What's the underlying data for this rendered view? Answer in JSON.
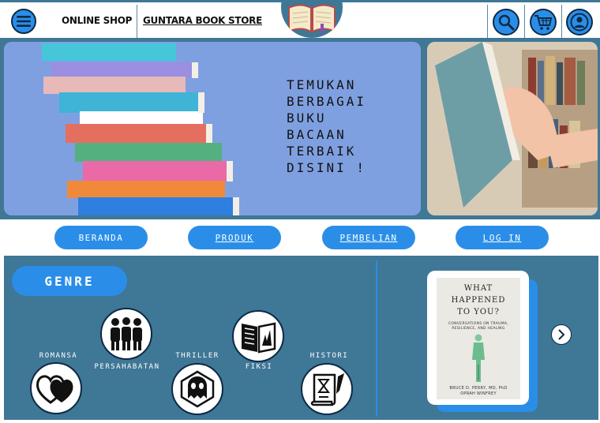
{
  "header": {
    "menu_icon": "hamburger-icon",
    "shop_label": "ONLINE SHOP",
    "store_name": "GUNTARA BOOK STORE",
    "logo_icon": "open-book-icon",
    "actions": [
      {
        "icon": "search-icon"
      },
      {
        "icon": "cart-icon"
      },
      {
        "icon": "user-icon"
      }
    ]
  },
  "banner": {
    "headline_lines": [
      "TEMUKAN",
      "BERBAGAI",
      "BUKU",
      "BACAAN",
      "TERBAIK",
      "DISINI !"
    ]
  },
  "nav": {
    "items": [
      {
        "label": "BERANDA"
      },
      {
        "label": "PRODUK"
      },
      {
        "label": "PEMBELIAN"
      },
      {
        "label": "LOG IN"
      }
    ]
  },
  "genre": {
    "button_label": "GENRE",
    "items": [
      {
        "label": "ROMANSA",
        "icon": "hearts-icon"
      },
      {
        "label": "PERSAHABATAN",
        "icon": "friends-icon"
      },
      {
        "label": "THRILLER",
        "icon": "ghost-icon"
      },
      {
        "label": "FIKSI",
        "icon": "book-icon"
      },
      {
        "label": "HISTORI",
        "icon": "scroll-icon"
      }
    ]
  },
  "featured_book": {
    "title_lines": [
      "WHAT",
      "HAPPENED",
      "TO YOU?"
    ],
    "subtitle_lines": [
      "CONVERSATIONS ON TRAUMA,",
      "RESILIENCE, AND HEALING"
    ],
    "author_lines": [
      "BRUCE D. PERRY, MD, PhD",
      "OPRAH WINFREY"
    ],
    "next_icon": "chevron-right-icon"
  },
  "colors": {
    "primary_blue": "#2a8ee8",
    "section_bg": "#3f7796",
    "dark_outline": "#0d2a45"
  }
}
